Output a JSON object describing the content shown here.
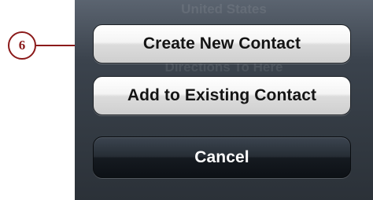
{
  "callout": {
    "number": "6"
  },
  "background": {
    "top_text": "United States",
    "middle_text": "Directions To Here"
  },
  "actions": {
    "create_new": "Create New Contact",
    "add_existing": "Add to Existing Contact",
    "cancel": "Cancel"
  },
  "colors": {
    "callout": "#8b1a1a",
    "sheet": "#3b434d",
    "light_button": "#f4f4f4",
    "cancel_button": "#151a20"
  }
}
